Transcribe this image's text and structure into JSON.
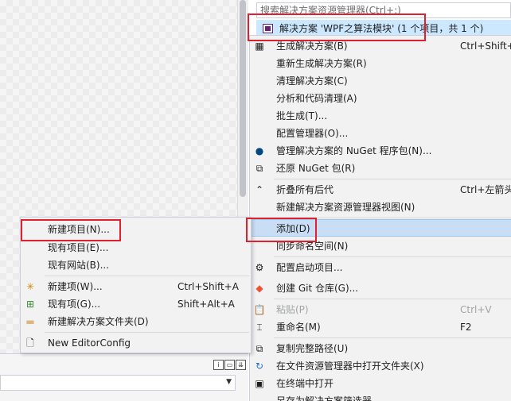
{
  "search": {
    "placeholder": "搜索解决方案资源管理器(Ctrl+;)"
  },
  "solution_root": {
    "label": "解决方案 'WPF之算法模块' (1 个项目，共 1 个)"
  },
  "context_menu": {
    "items": [
      {
        "label": "生成解决方案(B)",
        "shortcut": "Ctrl+Shift+B",
        "icon": "build-solution-icon"
      },
      {
        "label": "重新生成解决方案(R)",
        "shortcut": "",
        "icon": ""
      },
      {
        "label": "清理解决方案(C)",
        "shortcut": "",
        "icon": ""
      },
      {
        "label": "分析和代码清理(A)",
        "shortcut": "",
        "icon": ""
      },
      {
        "label": "批生成(T)...",
        "shortcut": "",
        "icon": ""
      },
      {
        "label": "配置管理器(O)...",
        "shortcut": "",
        "icon": ""
      },
      {
        "label": "管理解决方案的 NuGet 程序包(N)...",
        "shortcut": "",
        "icon": "nuget-icon"
      },
      {
        "label": "还原 NuGet 包(R)",
        "shortcut": "",
        "icon": "restore-package-icon"
      },
      {
        "label": "折叠所有后代",
        "shortcut": "Ctrl+左箭头",
        "icon": "collapse-icon"
      },
      {
        "label": "新建解决方案资源管理器视图(N)",
        "shortcut": "",
        "icon": ""
      },
      {
        "label": "添加(D)",
        "shortcut": "",
        "icon": ""
      },
      {
        "label": "同步命名空间(N)",
        "shortcut": "",
        "icon": ""
      },
      {
        "label": "配置启动项目...",
        "shortcut": "",
        "icon": "gear-icon"
      },
      {
        "label": "创建 Git 仓库(G)...",
        "shortcut": "",
        "icon": "git-icon"
      },
      {
        "label": "粘贴(P)",
        "shortcut": "Ctrl+V",
        "icon": "paste-icon"
      },
      {
        "label": "重命名(M)",
        "shortcut": "F2",
        "icon": "rename-icon"
      },
      {
        "label": "复制完整路径(U)",
        "shortcut": "",
        "icon": "copy-path-icon"
      },
      {
        "label": "在文件资源管理器中打开文件夹(X)",
        "shortcut": "",
        "icon": "open-folder-icon"
      },
      {
        "label": "在终端中打开",
        "shortcut": "",
        "icon": "terminal-icon"
      },
      {
        "label": "另存为解决方案筛选器",
        "shortcut": "",
        "icon": ""
      }
    ]
  },
  "add_submenu": {
    "items": [
      {
        "label": "新建项目(N)...",
        "shortcut": "",
        "icon": ""
      },
      {
        "label": "现有项目(E)...",
        "shortcut": "",
        "icon": ""
      },
      {
        "label": "现有网站(B)...",
        "shortcut": "",
        "icon": ""
      },
      {
        "label": "新建项(W)...",
        "shortcut": "Ctrl+Shift+A",
        "icon": "new-item-icon"
      },
      {
        "label": "现有项(G)...",
        "shortcut": "Shift+Alt+A",
        "icon": "existing-item-icon"
      },
      {
        "label": "新建解决方案文件夹(D)",
        "shortcut": "",
        "icon": "new-folder-icon"
      },
      {
        "label": "New EditorConfig",
        "shortcut": "",
        "icon": "editorconfig-icon"
      }
    ]
  },
  "colors": {
    "highlight": "#c9def5",
    "selection": "#cce8ff",
    "annotation": "#e0202e"
  }
}
